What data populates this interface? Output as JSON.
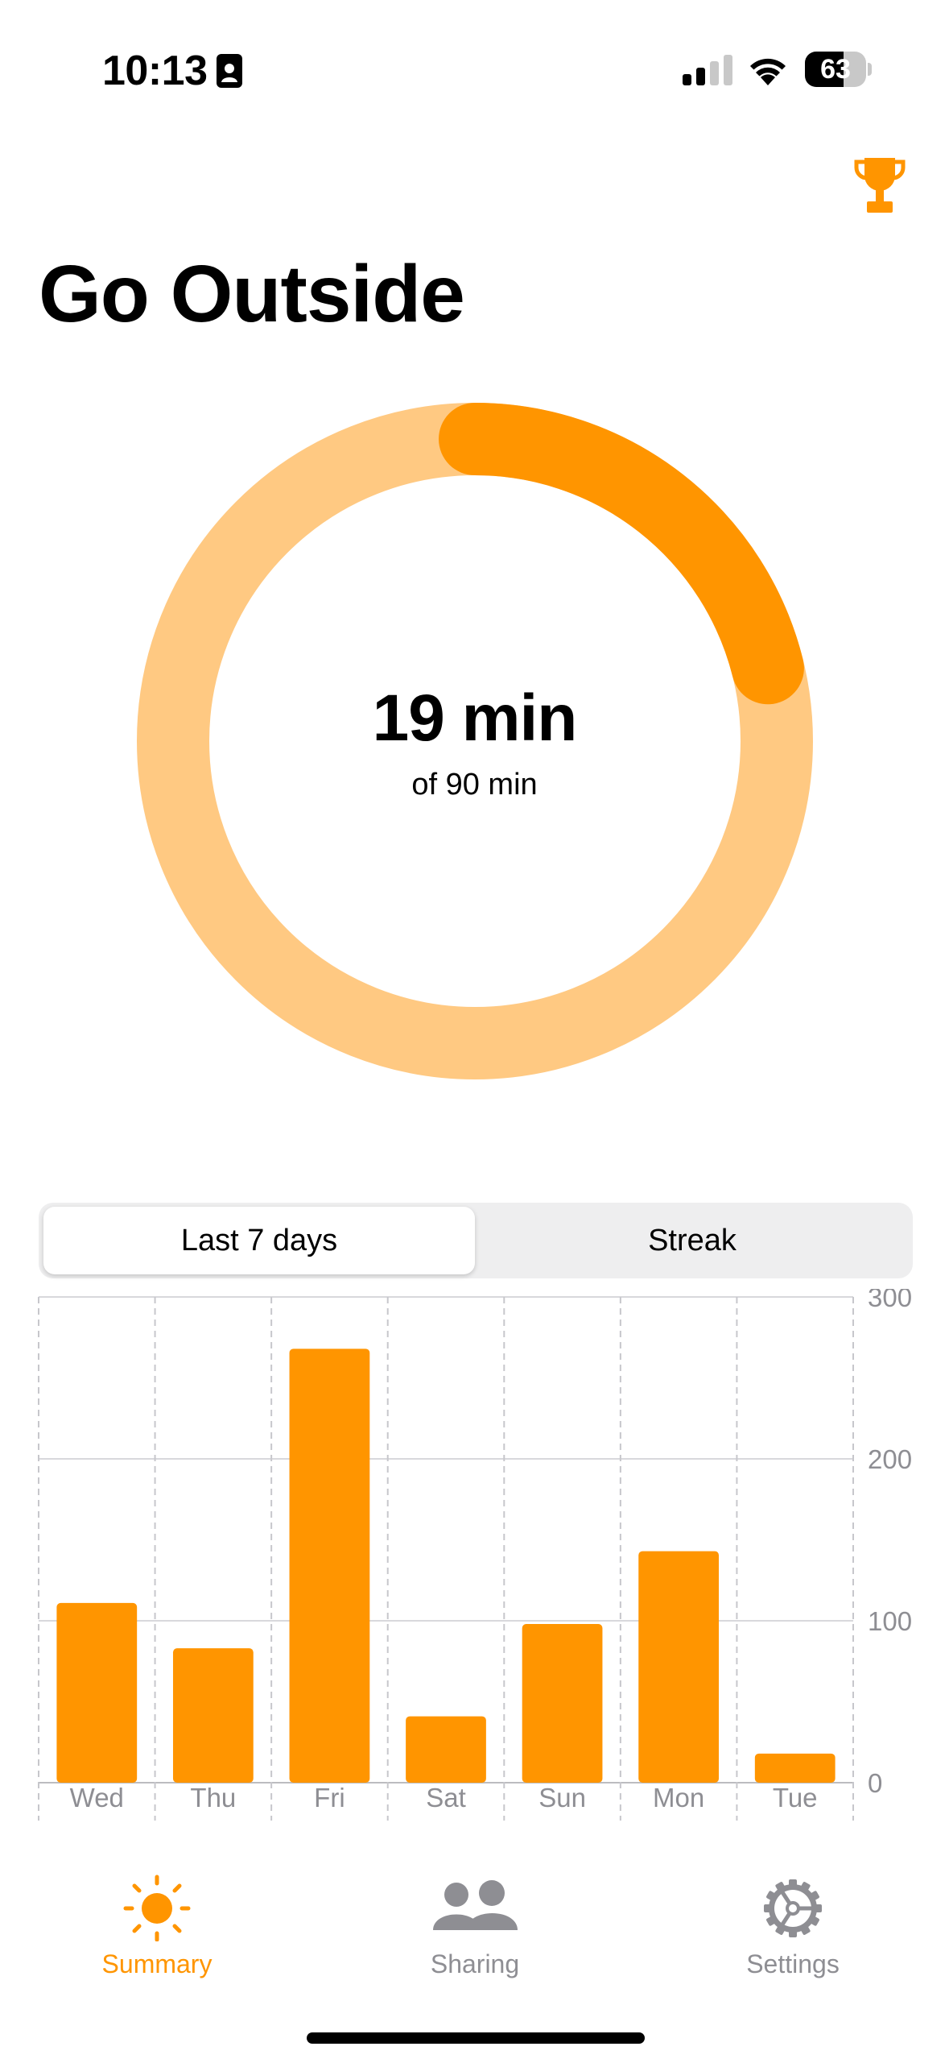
{
  "status_bar": {
    "time": "10:13",
    "battery": "63",
    "battery_level": 0.63
  },
  "header": {
    "title": "Go Outside"
  },
  "progress": {
    "value_label": "19 min",
    "goal_label": "of 90 min",
    "value": 19,
    "goal": 90
  },
  "segmented": {
    "options": [
      "Last 7 days",
      "Streak"
    ],
    "selected": "Last 7 days"
  },
  "chart_data": {
    "type": "bar",
    "categories": [
      "Wed",
      "Thu",
      "Fri",
      "Sat",
      "Sun",
      "Mon",
      "Tue"
    ],
    "values": [
      111,
      83,
      268,
      41,
      98,
      143,
      18
    ],
    "ylim": [
      0,
      300
    ],
    "yticks": [
      0,
      100,
      200,
      300
    ],
    "y_axis_position": "right",
    "grid": true,
    "bar_color": "#ff9500"
  },
  "tabbar": {
    "items": [
      "Summary",
      "Sharing",
      "Settings"
    ],
    "selected": "Summary"
  },
  "colors": {
    "accent": "#ff9500",
    "ring_track": "#ffc982",
    "inactive": "#8e8e93"
  }
}
